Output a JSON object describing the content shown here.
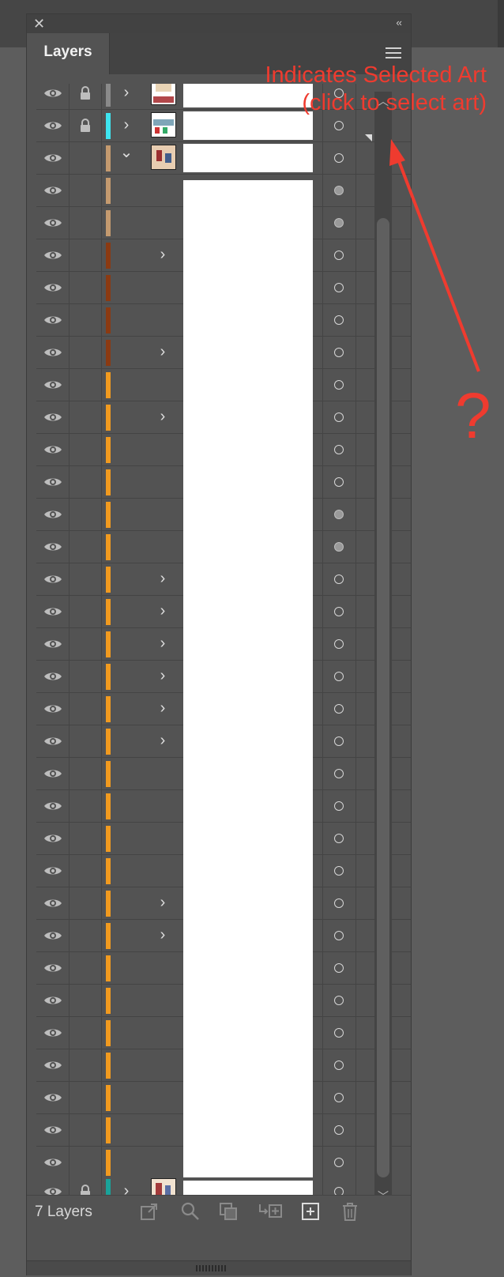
{
  "panel": {
    "tab_title": "Layers",
    "layers_count": "7 Layers"
  },
  "annotation": {
    "line1": "Indicates Selected Art",
    "line2": "(click to select art)",
    "question": "?"
  },
  "colors": {
    "gray": "#8a8a8a",
    "cyan": "#3ee5f0",
    "tan": "#c49a6f",
    "brown": "#8b3a12",
    "orange": "#f19a1f",
    "teal": "#1aa39a",
    "accent_red": "#ef3b2f"
  },
  "rows": [
    {
      "kind": "layer",
      "color": "gray",
      "lock": true,
      "expand": "right",
      "thumb": true,
      "target": "empty",
      "partial": true
    },
    {
      "kind": "layer",
      "color": "cyan",
      "lock": true,
      "expand": "right",
      "thumb": true,
      "target": "empty"
    },
    {
      "kind": "layer",
      "color": "tan",
      "lock": false,
      "expand": "down",
      "thumb": true,
      "target": "empty",
      "selected_art": true
    },
    {
      "kind": "sub",
      "color": "tan",
      "expand": "",
      "target": "filled"
    },
    {
      "kind": "sub",
      "color": "tan",
      "expand": "",
      "target": "filled"
    },
    {
      "kind": "sub",
      "color": "brown",
      "expand": "right",
      "target": "empty"
    },
    {
      "kind": "sub",
      "color": "brown",
      "expand": "",
      "target": "empty"
    },
    {
      "kind": "sub",
      "color": "brown",
      "expand": "",
      "target": "empty"
    },
    {
      "kind": "sub",
      "color": "brown",
      "expand": "right",
      "target": "empty"
    },
    {
      "kind": "sub",
      "color": "orange",
      "expand": "",
      "target": "empty"
    },
    {
      "kind": "sub",
      "color": "orange",
      "expand": "right",
      "target": "empty"
    },
    {
      "kind": "sub",
      "color": "orange",
      "expand": "",
      "target": "empty"
    },
    {
      "kind": "sub",
      "color": "orange",
      "expand": "",
      "target": "empty"
    },
    {
      "kind": "sub",
      "color": "orange",
      "expand": "",
      "target": "filled"
    },
    {
      "kind": "sub",
      "color": "orange",
      "expand": "",
      "target": "filled"
    },
    {
      "kind": "sub",
      "color": "orange",
      "expand": "right",
      "target": "empty"
    },
    {
      "kind": "sub",
      "color": "orange",
      "expand": "right",
      "target": "empty"
    },
    {
      "kind": "sub",
      "color": "orange",
      "expand": "right",
      "target": "empty"
    },
    {
      "kind": "sub",
      "color": "orange",
      "expand": "right",
      "target": "empty"
    },
    {
      "kind": "sub",
      "color": "orange",
      "expand": "right",
      "target": "empty"
    },
    {
      "kind": "sub",
      "color": "orange",
      "expand": "right",
      "target": "empty"
    },
    {
      "kind": "sub",
      "color": "orange",
      "expand": "",
      "target": "empty"
    },
    {
      "kind": "sub",
      "color": "orange",
      "expand": "",
      "target": "empty"
    },
    {
      "kind": "sub",
      "color": "orange",
      "expand": "",
      "target": "empty"
    },
    {
      "kind": "sub",
      "color": "orange",
      "expand": "",
      "target": "empty"
    },
    {
      "kind": "sub",
      "color": "orange",
      "expand": "right",
      "target": "empty"
    },
    {
      "kind": "sub",
      "color": "orange",
      "expand": "right",
      "target": "empty"
    },
    {
      "kind": "sub",
      "color": "orange",
      "expand": "",
      "target": "empty"
    },
    {
      "kind": "sub",
      "color": "orange",
      "expand": "",
      "target": "empty"
    },
    {
      "kind": "sub",
      "color": "orange",
      "expand": "",
      "target": "empty"
    },
    {
      "kind": "sub",
      "color": "orange",
      "expand": "",
      "target": "empty"
    },
    {
      "kind": "sub",
      "color": "orange",
      "expand": "",
      "target": "empty"
    },
    {
      "kind": "sub",
      "color": "orange",
      "expand": "",
      "target": "empty"
    },
    {
      "kind": "sub",
      "color": "orange",
      "expand": "",
      "target": "empty"
    },
    {
      "kind": "layer",
      "color": "teal",
      "lock": true,
      "expand": "right",
      "thumb": true,
      "target": "empty"
    }
  ],
  "bottom_icons": [
    "export-icon",
    "search-icon",
    "clipping-mask-icon",
    "sublayer-icon",
    "new-layer-icon",
    "trash-icon"
  ]
}
